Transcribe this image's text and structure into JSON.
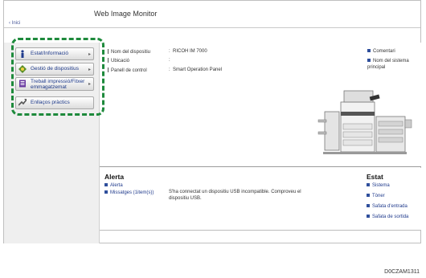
{
  "app_title": "Web Image Monitor",
  "home_link": "‹ Inici",
  "menu": [
    {
      "label": "Estat/Informació",
      "icon": "info-icon"
    },
    {
      "label": "Gestió de dispositius",
      "icon": "device-management-icon"
    },
    {
      "label": "Treball impressió/Fitxer emmagatzemat",
      "icon": "print-job-icon"
    },
    {
      "label": "Enllaços pràctics",
      "icon": "link-arrow-icon"
    }
  ],
  "device_info": [
    {
      "label": "Nom del dispositiu",
      "value": "RICOH IM 7000"
    },
    {
      "label": "Ubicació",
      "value": ""
    },
    {
      "label": "Panell de control",
      "value": "Smart Operation Panel"
    }
  ],
  "right_links": [
    "Comentari",
    "Nom del sistema principal"
  ],
  "alert": {
    "title": "Alerta",
    "items": [
      "Alerta",
      "Missatges (1item(s))"
    ],
    "message": "S'ha connectat un dispositiu USB incompatible. Comproveu el dispositiu USB."
  },
  "status": {
    "title": "Estat",
    "items": [
      "Sistema",
      "Tòner",
      "Safata d'entrada",
      "Safata de sortida"
    ]
  },
  "figure_code": "D0CZAM1311",
  "colors": {
    "highlight": "#1e8a3c",
    "link": "#1f3a8c"
  }
}
